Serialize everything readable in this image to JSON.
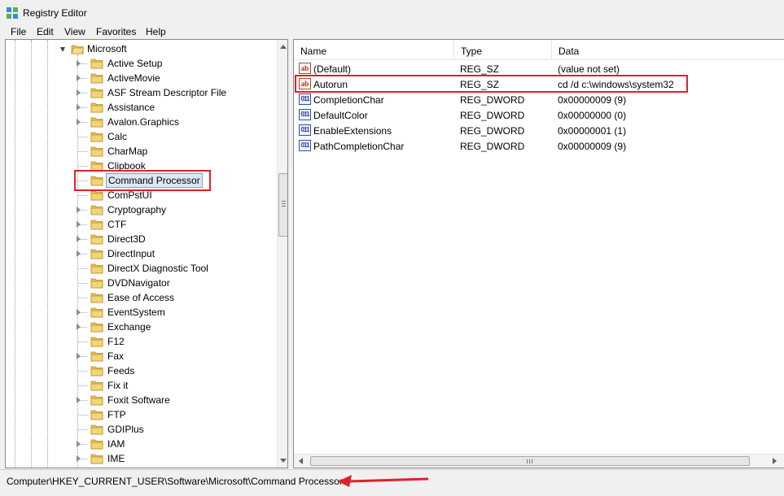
{
  "window": {
    "title": "Registry Editor"
  },
  "menu": [
    "File",
    "Edit",
    "View",
    "Favorites",
    "Help"
  ],
  "tree": {
    "parent": "Microsoft",
    "items": [
      {
        "label": "Active Setup",
        "expandable": true
      },
      {
        "label": "ActiveMovie",
        "expandable": true
      },
      {
        "label": "ASF Stream Descriptor File",
        "expandable": true
      },
      {
        "label": "Assistance",
        "expandable": true
      },
      {
        "label": "Avalon.Graphics",
        "expandable": true
      },
      {
        "label": "Calc",
        "expandable": false
      },
      {
        "label": "CharMap",
        "expandable": false
      },
      {
        "label": "Clipbook",
        "expandable": false
      },
      {
        "label": "Command Processor",
        "expandable": false,
        "selected": true
      },
      {
        "label": "ComPstUI",
        "expandable": false
      },
      {
        "label": "Cryptography",
        "expandable": true
      },
      {
        "label": "CTF",
        "expandable": true
      },
      {
        "label": "Direct3D",
        "expandable": true
      },
      {
        "label": "DirectInput",
        "expandable": true
      },
      {
        "label": "DirectX Diagnostic Tool",
        "expandable": false
      },
      {
        "label": "DVDNavigator",
        "expandable": false
      },
      {
        "label": "Ease of Access",
        "expandable": false
      },
      {
        "label": "EventSystem",
        "expandable": true
      },
      {
        "label": "Exchange",
        "expandable": true
      },
      {
        "label": "F12",
        "expandable": false
      },
      {
        "label": "Fax",
        "expandable": true
      },
      {
        "label": "Feeds",
        "expandable": false
      },
      {
        "label": "Fix it",
        "expandable": false
      },
      {
        "label": "Foxit Software",
        "expandable": true
      },
      {
        "label": "FTP",
        "expandable": false
      },
      {
        "label": "GDIPlus",
        "expandable": false
      },
      {
        "label": "IAM",
        "expandable": true
      },
      {
        "label": "IME",
        "expandable": true
      }
    ]
  },
  "list": {
    "columns": [
      "Name",
      "Type",
      "Data"
    ],
    "rows": [
      {
        "icon": "string-value-icon",
        "name": "(Default)",
        "type": "REG_SZ",
        "data": "(value not set)"
      },
      {
        "icon": "string-value-icon",
        "name": "Autorun",
        "type": "REG_SZ",
        "data": "cd /d c:\\windows\\system32",
        "highlighted": true
      },
      {
        "icon": "binary-value-icon",
        "name": "CompletionChar",
        "type": "REG_DWORD",
        "data": "0x00000009 (9)"
      },
      {
        "icon": "binary-value-icon",
        "name": "DefaultColor",
        "type": "REG_DWORD",
        "data": "0x00000000 (0)"
      },
      {
        "icon": "binary-value-icon",
        "name": "EnableExtensions",
        "type": "REG_DWORD",
        "data": "0x00000001 (1)"
      },
      {
        "icon": "binary-value-icon",
        "name": "PathCompletionChar",
        "type": "REG_DWORD",
        "data": "0x00000009 (9)"
      }
    ]
  },
  "status": {
    "path": "Computer\\HKEY_CURRENT_USER\\Software\\Microsoft\\Command Processor"
  },
  "colors": {
    "annotation": "#e0202a",
    "folder": "#e8c15a"
  }
}
